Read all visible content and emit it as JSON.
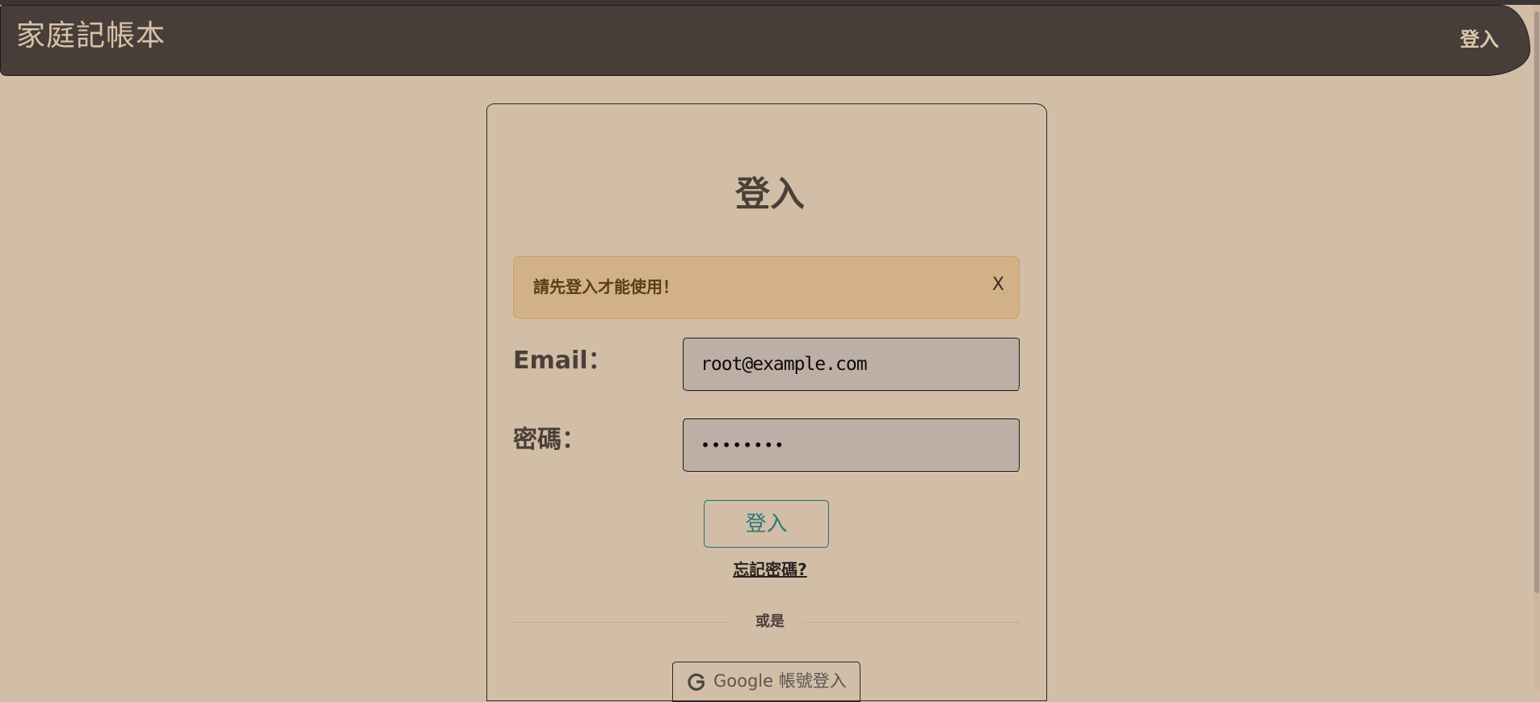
{
  "navbar": {
    "brand": "家庭記帳本",
    "login_link": "登入"
  },
  "login_card": {
    "title": "登入",
    "alert": {
      "message": "請先登入才能使用！",
      "close_label": "X"
    },
    "email": {
      "label": "Email：",
      "value": "root@example.com"
    },
    "password": {
      "label": "密碼：",
      "value": "12345678"
    },
    "submit_label": "登入",
    "forgot_password": "忘記密碼?",
    "divider_text": "或是",
    "google_button": {
      "label": "Google 帳號登入",
      "icon": "google-icon"
    }
  },
  "colors": {
    "background": "#d2bda6",
    "navbar": "#483e39",
    "alert_background": "#d2b186",
    "input_background": "#beafa6",
    "accent": "#27777c"
  }
}
